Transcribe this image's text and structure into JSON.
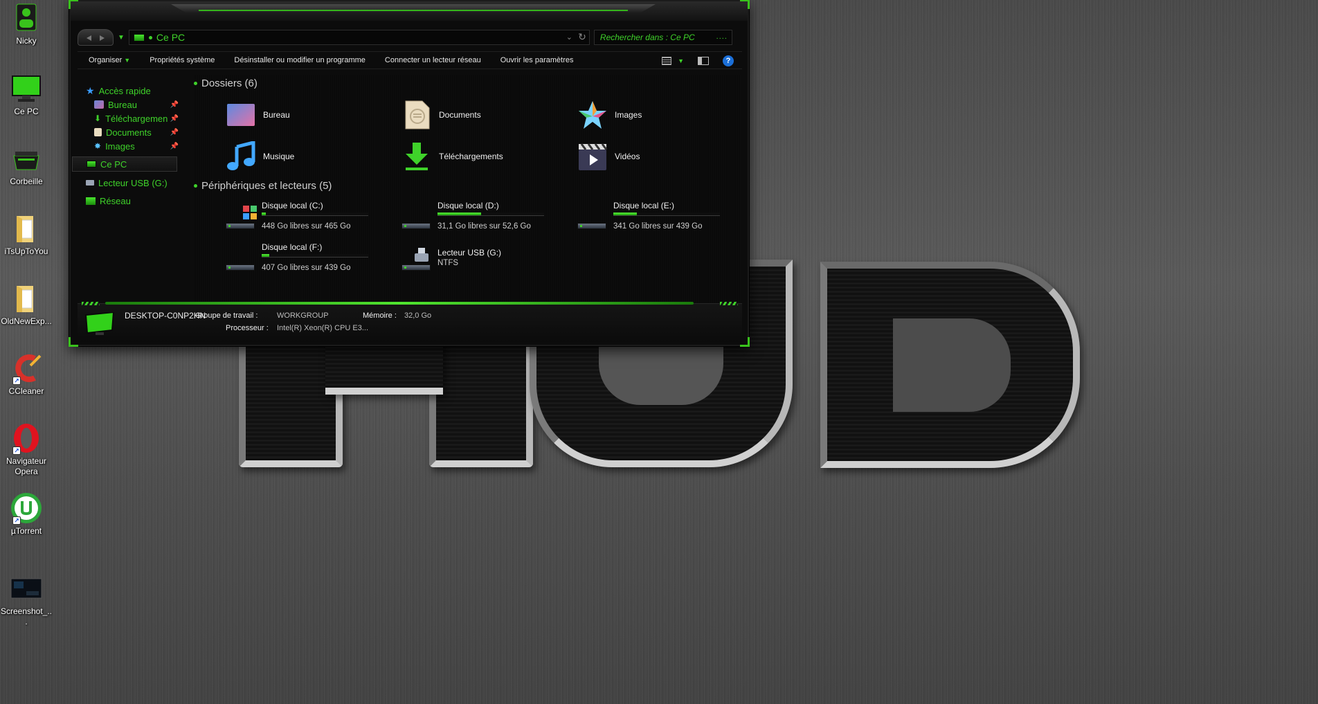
{
  "desktop": {
    "icons": [
      {
        "label": "Nicky",
        "icon": "user-icon"
      },
      {
        "label": "Ce PC",
        "icon": "computer-icon"
      },
      {
        "label": "Corbeille",
        "icon": "recycle-bin-icon"
      },
      {
        "label": "iTsUpToYou",
        "icon": "folder-icon"
      },
      {
        "label": "OldNewExp...",
        "icon": "folder-icon"
      },
      {
        "label": "CCleaner",
        "icon": "ccleaner-icon"
      },
      {
        "label": "Navigateur Opera",
        "icon": "opera-icon"
      },
      {
        "label": "µTorrent",
        "icon": "utorrent-icon"
      },
      {
        "label": "Screenshot_...",
        "icon": "screenshot-icon"
      }
    ]
  },
  "explorer": {
    "address": "Ce PC",
    "search_placeholder": "Rechercher dans : Ce PC",
    "search_dots": "....",
    "toolbar": {
      "organize": "Organiser",
      "system_properties": "Propriétés système",
      "uninstall": "Désinstaller ou modifier un programme",
      "map_drive": "Connecter un lecteur réseau",
      "open_settings": "Ouvrir les paramètres",
      "help": "?"
    },
    "nav": {
      "quick_access": "Accès rapide",
      "desktop": "Bureau",
      "downloads": "Téléchargemen",
      "documents": "Documents",
      "images": "Images",
      "this_pc": "Ce PC",
      "usb": "Lecteur USB (G:)",
      "network": "Réseau"
    },
    "folders_header": "Dossiers (6)",
    "folders": [
      {
        "name": "Bureau",
        "icon": "desktop-folder-icon"
      },
      {
        "name": "Documents",
        "icon": "documents-folder-icon"
      },
      {
        "name": "Images",
        "icon": "pictures-folder-icon"
      },
      {
        "name": "Musique",
        "icon": "music-folder-icon"
      },
      {
        "name": "Téléchargements",
        "icon": "downloads-folder-icon"
      },
      {
        "name": "Vidéos",
        "icon": "videos-folder-icon"
      }
    ],
    "devices_header": "Périphériques et lecteurs (5)",
    "drives": [
      {
        "name": "Disque local (C:)",
        "free": "448 Go libres sur 465 Go",
        "used_fraction": 0.04,
        "icon": "windows-drive-icon"
      },
      {
        "name": "Disque local (D:)",
        "free": "31,1 Go libres sur 52,6 Go",
        "used_fraction": 0.41,
        "icon": "hard-drive-icon"
      },
      {
        "name": "Disque local (E:)",
        "free": "341 Go libres sur 439 Go",
        "used_fraction": 0.22,
        "icon": "hard-drive-icon"
      },
      {
        "name": "Disque local (F:)",
        "free": "407 Go libres sur 439 Go",
        "used_fraction": 0.07,
        "icon": "hard-drive-icon"
      },
      {
        "name": "Lecteur USB (G:)",
        "free": "NTFS",
        "used_fraction": null,
        "icon": "usb-drive-icon"
      }
    ],
    "details": {
      "computer_name": "DESKTOP-C0NP2HN",
      "workgroup_label": "Groupe de travail :",
      "workgroup_value": "WORKGROUP",
      "memory_label": "Mémoire :",
      "memory_value": "32,0 Go",
      "processor_label": "Processeur :",
      "processor_value": "Intel(R) Xeon(R) CPU E3..."
    }
  },
  "colors": {
    "accent": "#3fd22a",
    "window_bg": "#0c0c0c"
  }
}
